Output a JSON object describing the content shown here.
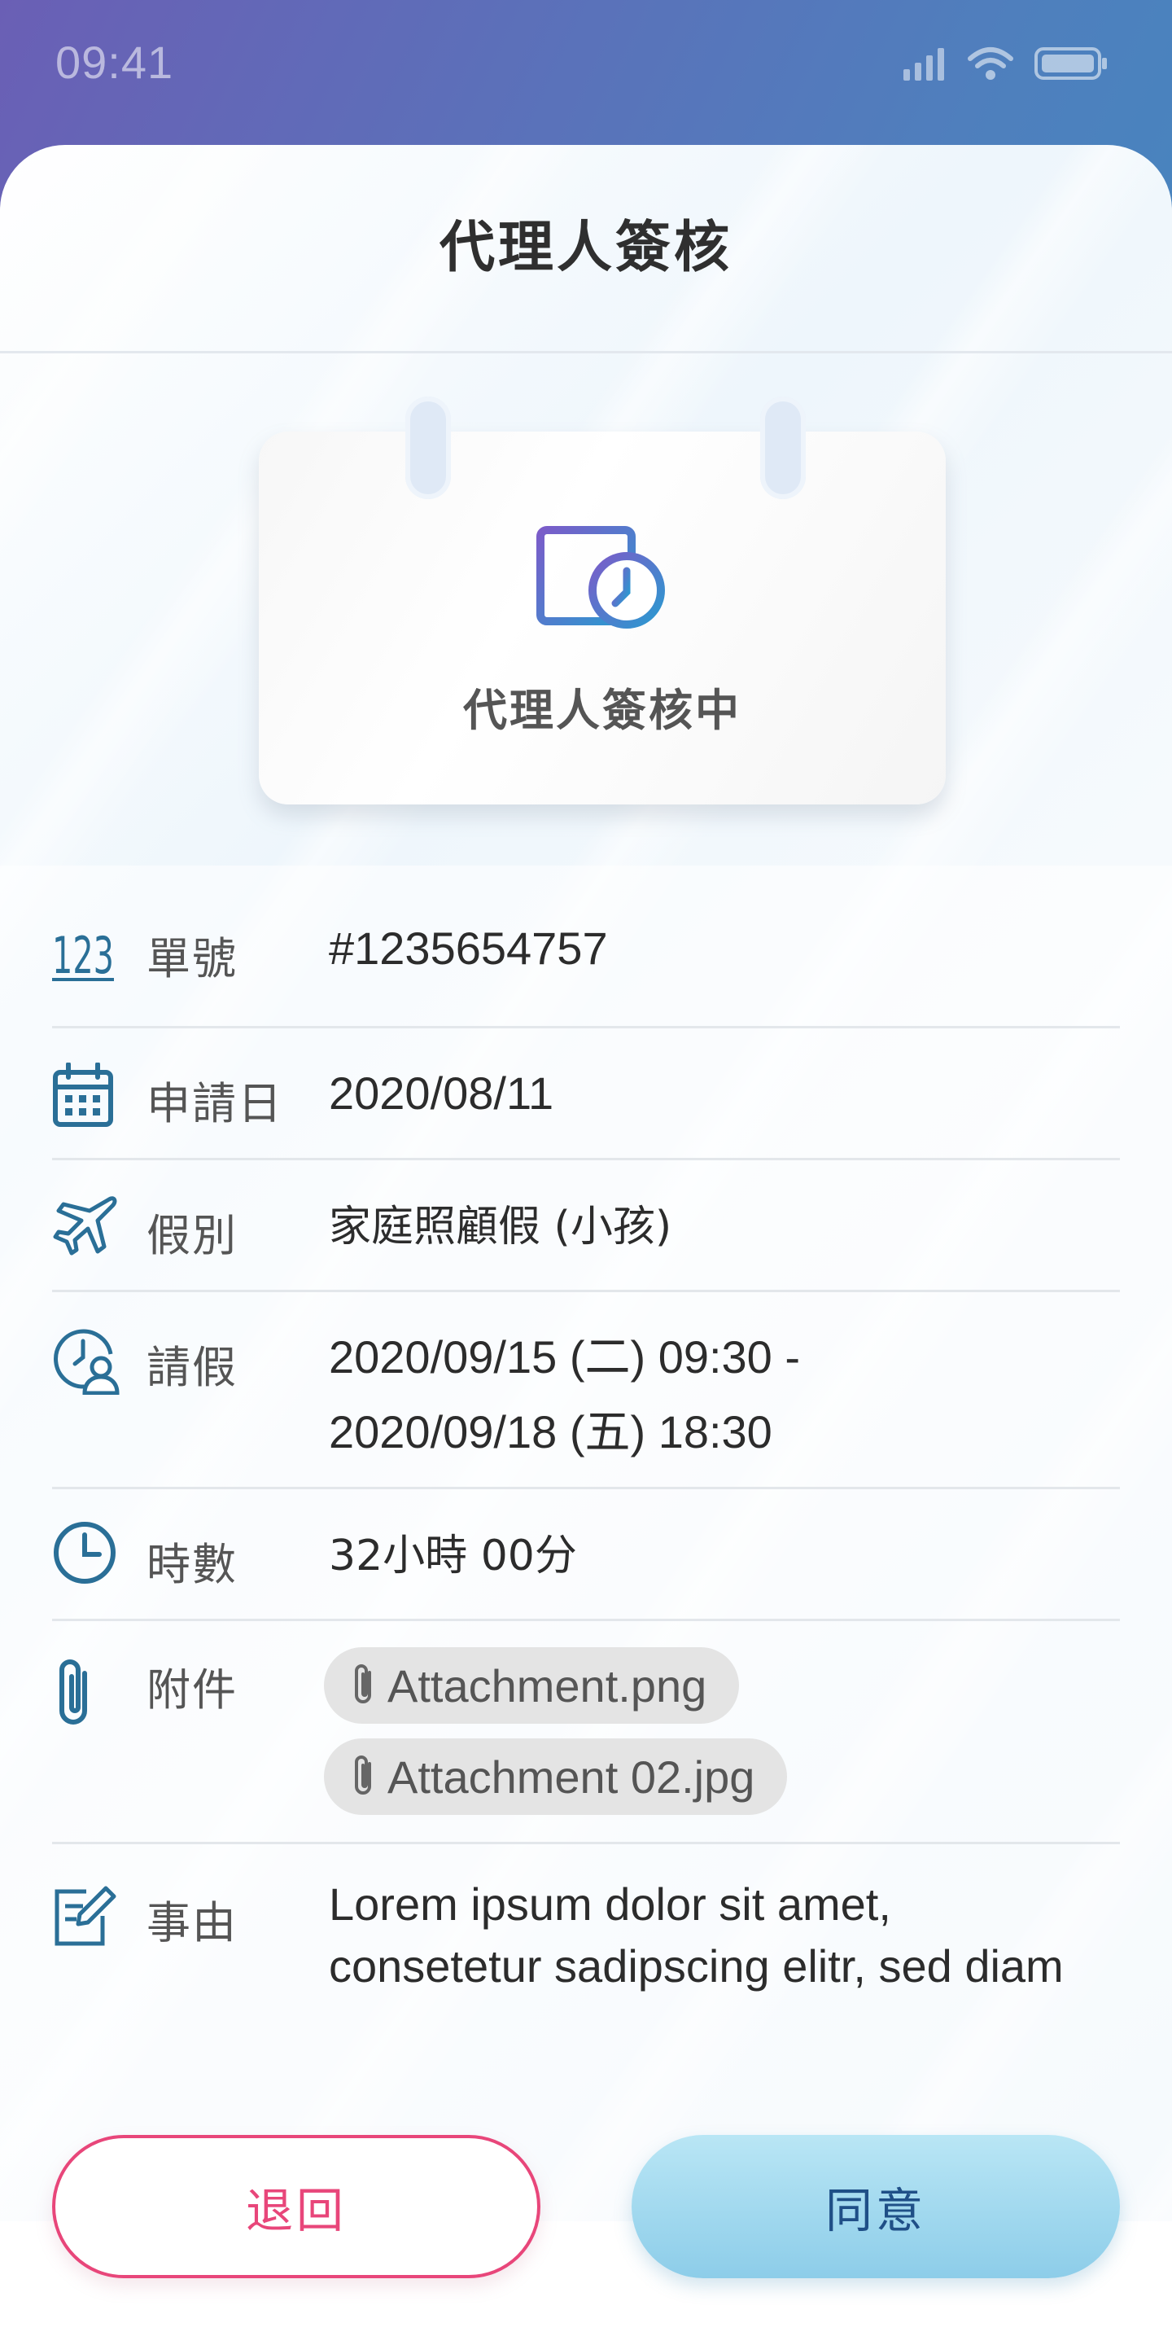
{
  "status_bar": {
    "time": "09:41"
  },
  "header": {
    "title": "代理人簽核"
  },
  "status_card": {
    "label": "代理人簽核中"
  },
  "details": {
    "order_no": {
      "label": "單號",
      "value": "#1235654757"
    },
    "apply_date": {
      "label": "申請日",
      "value": "2020/08/11"
    },
    "leave_type": {
      "label": "假別",
      "value": "家庭照顧假 (小孩)"
    },
    "leave_period": {
      "label": "請假",
      "line1": "2020/09/15 (二)  09:30 -",
      "line2": "2020/09/18 (五)  18:30"
    },
    "duration": {
      "label": "時數",
      "value": "32小時   00分"
    },
    "attachments": {
      "label": "附件",
      "files": [
        "Attachment.png",
        "Attachment 02.jpg"
      ]
    },
    "reason": {
      "label": "事由",
      "line1": "Lorem ipsum dolor sit amet,",
      "line2": "consetetur sadipscing elitr, sed diam"
    }
  },
  "actions": {
    "reject_label": "退回",
    "approve_label": "同意"
  },
  "colors": {
    "accent_blue": "#2a6f97",
    "reject_pink": "#e8467a",
    "approve_bg": "#a6dbf0"
  }
}
